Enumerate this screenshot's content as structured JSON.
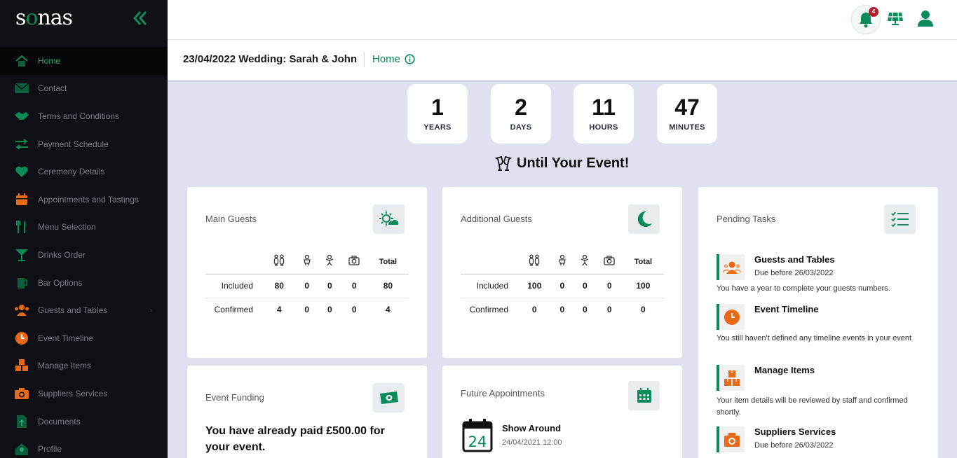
{
  "app": {
    "logo_text_1": "s",
    "logo_text_2": "o",
    "logo_text_3": "nas"
  },
  "sidebar": {
    "items": [
      {
        "label": "Home",
        "icon": "home-icon"
      },
      {
        "label": "Contact",
        "icon": "envelope-icon"
      },
      {
        "label": "Terms and Conditions",
        "icon": "handshake-icon"
      },
      {
        "label": "Payment Schedule",
        "icon": "transfer-arrows-icon"
      },
      {
        "label": "Ceremony Details",
        "icon": "heart-icon"
      },
      {
        "label": "Appointments and Tastings",
        "icon": "calendar-icon"
      },
      {
        "label": "Menu Selection",
        "icon": "utensils-icon"
      },
      {
        "label": "Drinks Order",
        "icon": "cocktail-icon"
      },
      {
        "label": "Bar Options",
        "icon": "beer-icon"
      },
      {
        "label": "Guests and Tables",
        "icon": "users-icon"
      },
      {
        "label": "Event Timeline",
        "icon": "clock-icon"
      },
      {
        "label": "Manage Items",
        "icon": "boxes-icon"
      },
      {
        "label": "Suppliers Services",
        "icon": "camera-icon"
      },
      {
        "label": "Documents",
        "icon": "document-upload-icon"
      },
      {
        "label": "Profile",
        "icon": "profile-icon"
      }
    ],
    "chevron": "›"
  },
  "topbar": {
    "notification_count": "4"
  },
  "subbar": {
    "event_title": "23/04/2022 Wedding: Sarah & John",
    "breadcrumb": "Home"
  },
  "countdown": [
    {
      "value": "1",
      "label": "YEARS"
    },
    {
      "value": "2",
      "label": "DAYS"
    },
    {
      "value": "11",
      "label": "HOURS"
    },
    {
      "value": "47",
      "label": "MINUTES"
    }
  ],
  "until_text": "Until Your Event!",
  "main_guests": {
    "title": "Main Guests",
    "total_label": "Total",
    "rows": [
      {
        "label": "Included",
        "values": [
          "80",
          "0",
          "0",
          "0",
          "80"
        ]
      },
      {
        "label": "Confirmed",
        "values": [
          "4",
          "0",
          "0",
          "0",
          "4"
        ]
      }
    ]
  },
  "additional_guests": {
    "title": "Additional Guests",
    "total_label": "Total",
    "rows": [
      {
        "label": "Included",
        "values": [
          "100",
          "0",
          "0",
          "0",
          "100"
        ]
      },
      {
        "label": "Confirmed",
        "values": [
          "0",
          "0",
          "0",
          "0",
          "0"
        ]
      }
    ]
  },
  "event_funding": {
    "title": "Event Funding",
    "text": "You have already paid £500.00 for your event."
  },
  "future_appointments": {
    "title": "Future Appointments",
    "items": [
      {
        "day": "24",
        "name": "Show Around",
        "date": "24/04/2021 12:00"
      }
    ]
  },
  "pending_tasks": {
    "title": "Pending Tasks",
    "items": [
      {
        "title": "Guests and Tables",
        "due": "Due before 26/03/2022",
        "desc": "You have a year to complete your guests numbers."
      },
      {
        "title": "Event Timeline",
        "due": "",
        "desc": "You still haven't defined any timeline events in your event"
      },
      {
        "title": "Manage Items",
        "due": "",
        "desc": "Your item details will be reviewed by staff and confirmed shortly."
      },
      {
        "title": "Suppliers Services",
        "due": "Due before 26/03/2022",
        "desc": ""
      }
    ]
  },
  "colors": {
    "brand_green": "#0b8a5a",
    "sidebar_bg": "#0e1015",
    "page_bg": "#dfe1f1",
    "orange": "#e86a16",
    "badge_red": "#b3202a"
  }
}
